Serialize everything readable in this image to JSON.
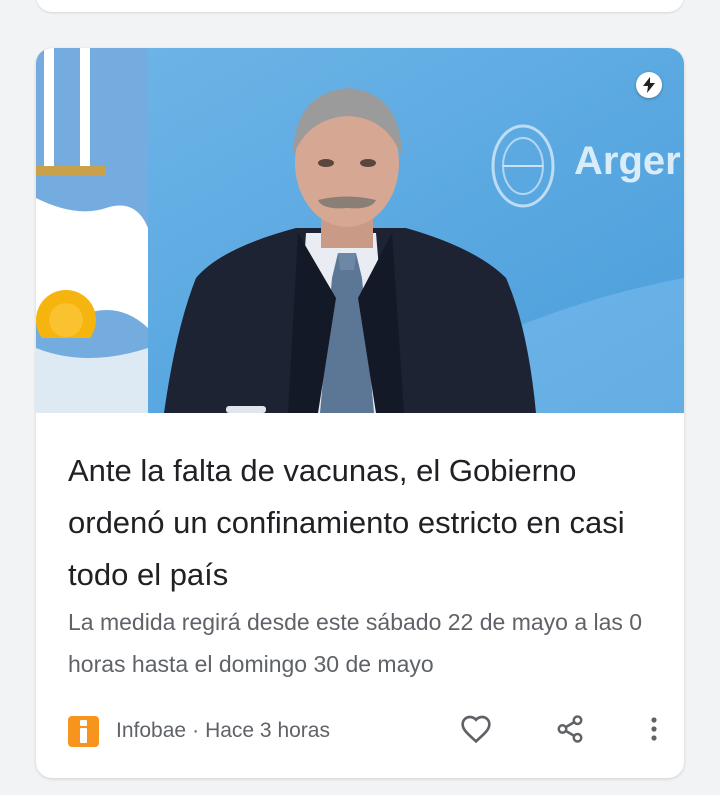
{
  "article": {
    "title": "Ante la falta de vacunas, el Gobierno ordenó un confinamiento estricto en casi todo el país",
    "snippet": "La medida regirá desde este sábado 22 de mayo a las 0 horas hasta el domingo 30 de mayo",
    "source": "Infobae",
    "separator": "·",
    "time": "Hace 3 horas",
    "image_text": "Arger",
    "accent_color": "#f7941d"
  },
  "icons": {
    "amp": "amp-lightning-icon",
    "source_logo": "infobae-logo-icon",
    "like": "heart-icon",
    "share": "share-icon",
    "more": "more-vert-icon"
  }
}
